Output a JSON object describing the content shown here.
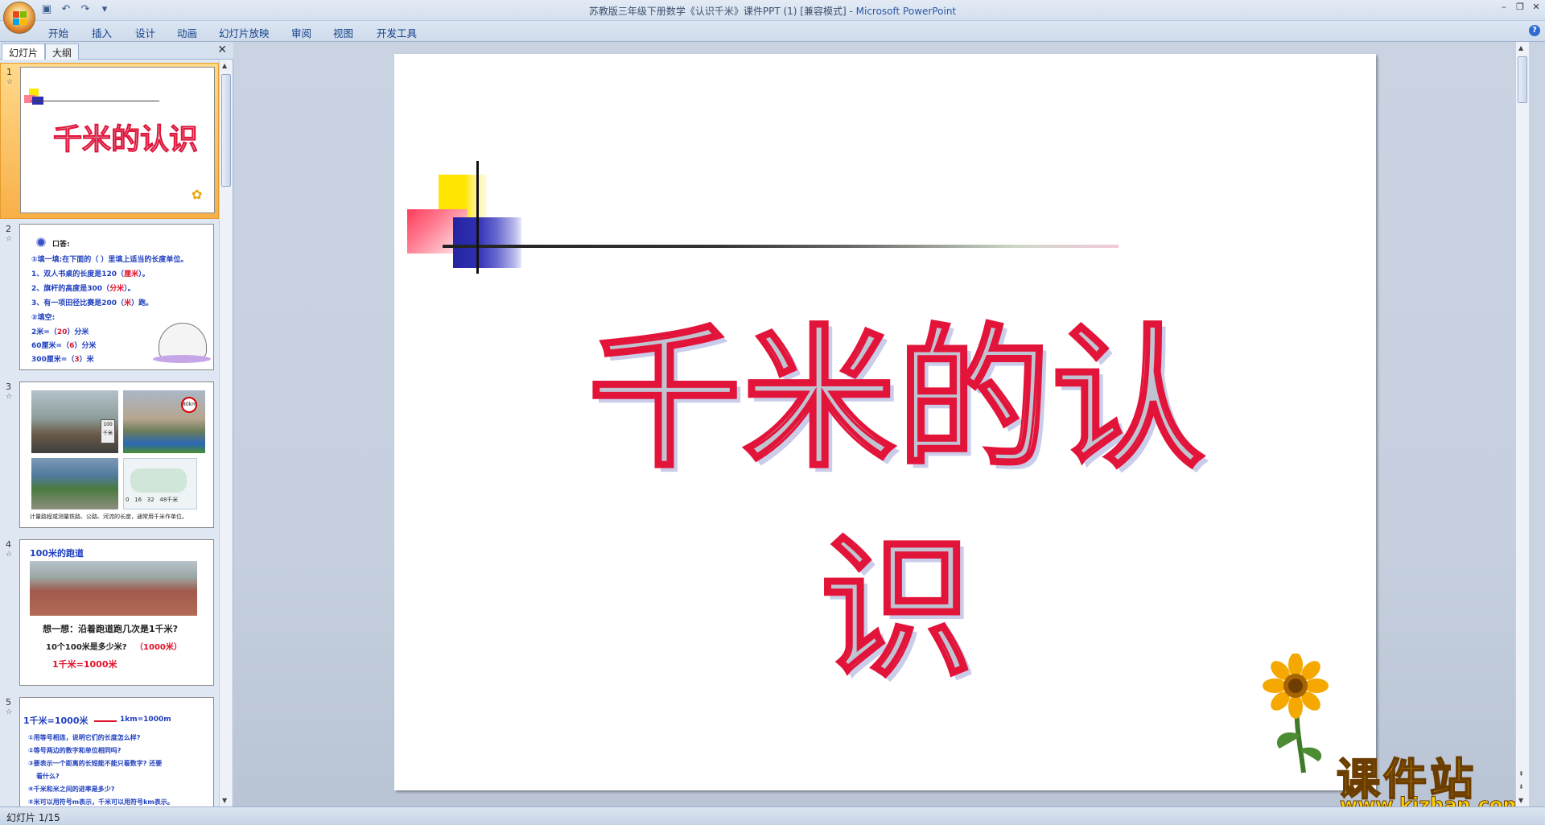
{
  "window": {
    "title": "苏教版三年级下册数学《认识千米》课件PPT (1) [兼容模式] - ",
    "app_name": "Microsoft PowerPoint"
  },
  "ribbon_tabs": [
    "开始",
    "插入",
    "设计",
    "动画",
    "幻灯片放映",
    "审阅",
    "视图",
    "开发工具"
  ],
  "panel": {
    "tab_slides": "幻灯片",
    "tab_outline": "大纲"
  },
  "thumbnails": [
    {
      "num": "1",
      "title": "千米的认识"
    },
    {
      "num": "2",
      "lines": [
        "口答:",
        "①填一填:在下面的（ ）里填上适当的长度单位。",
        "1、双人书桌的长度是120（",
        "厘米",
        "）。",
        "2、旗杆的高度是300（",
        "分米",
        "）。",
        "3、有一项田径比赛是200（",
        "米",
        "）跑。",
        "②填空:",
        "2米=（",
        "20",
        "）分米",
        "60厘米=（",
        "6",
        "）分米",
        "300厘米=（",
        "3",
        "）米"
      ]
    },
    {
      "num": "3",
      "caption": "计量路程或测量铁路、公路、河流的长度，通常用千米作单位。",
      "signs": [
        "100",
        "千米",
        "80km",
        "0",
        "16",
        "32",
        "48千米"
      ]
    },
    {
      "num": "4",
      "lines": [
        "100米的跑道",
        "想一想：沿着跑道跑几次是1千米?",
        "10个100米是多少米?",
        "（1000米）",
        "1千米=1000米"
      ]
    },
    {
      "num": "5",
      "lines": [
        "1千米=1000米",
        "1km=1000m",
        "①用等号相连，说明它们的长度怎么样?",
        "②等号两边的数字和单位相同吗?",
        "③要表示一个距离的长短能不能只看数字? 还要",
        "看什么?",
        "④千米和米之间的进率是多少?",
        "⑤米可以用符号m表示，千米可以用符号km表示。"
      ]
    }
  ],
  "slide": {
    "title": "千米的认识"
  },
  "watermark": {
    "text": "课件站",
    "url": "www.kjzhan.com"
  },
  "status": {
    "slide_indicator": "幻灯片 1/15"
  }
}
